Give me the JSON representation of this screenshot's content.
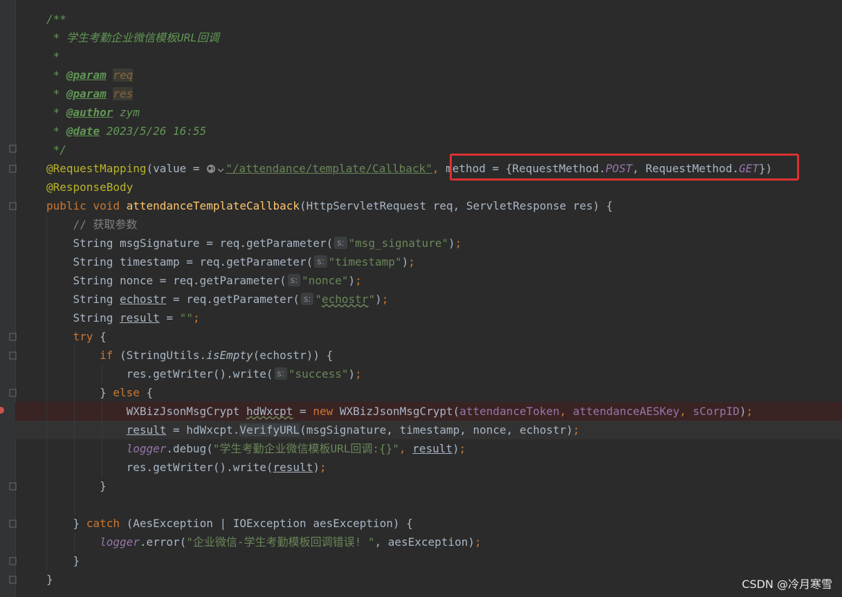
{
  "editor": {
    "javadoc": {
      "open": "/**",
      "star": " *",
      "description": " 学生考勤企业微信模板URL回调",
      "param_tag": "@param",
      "param1": "req",
      "param2": "res",
      "author_tag": "@author",
      "author": " zym",
      "date_tag": "@date",
      "date": " 2023/5/26 16:55",
      "close": " */"
    },
    "mapping": {
      "annotation": "@RequestMapping",
      "value_prefix": "(value = ",
      "url": "\"/attendance/template/Callback\"",
      "comma": ",",
      "method_part_1": " method = {RequestMethod.",
      "post": "POST",
      "method_part_2": ", RequestMethod.",
      "get": "GET",
      "method_part_3": "})"
    },
    "response_body": "@ResponseBody",
    "signature": {
      "modifiers": "public void ",
      "name": "attendanceTemplateCallback",
      "params": "(HttpServletRequest req, ServletResponse res) {"
    },
    "comment_line": "// 获取参数",
    "hint_s": "s:",
    "vars": {
      "msg": "String msgSignature = req.getParameter(",
      "msg_arg": "\"msg_signature\"",
      "ts": "String timestamp = req.getParameter(",
      "ts_arg": "\"timestamp\"",
      "nonce": "String nonce = req.getParameter(",
      "nonce_arg": "\"nonce\"",
      "echo_prefix": "String ",
      "echo_name": "echostr",
      "echo_mid": " = req.getParameter(",
      "echo_arg_q1": "\"",
      "echo_arg": "echostr",
      "echo_arg_q2": "\"",
      "result_prefix": "String ",
      "result_name": "result",
      "result_mid": " = ",
      "result_val": "\"\"",
      "close_paren_semi": ")",
      "semi": ";"
    },
    "try_block": {
      "try_kw": "try",
      "open_brace": " {",
      "if_kw": "if",
      "if_pre": " (StringUtils.",
      "is_empty": "isEmpty",
      "if_post": "(echostr)) {",
      "write_success": "res.getWriter().write(",
      "success_arg": "\"success\"",
      "else_close": "} ",
      "else_kw": "else",
      "crypt_type": "WXBizJsonMsgCrypt ",
      "crypt_var": "hdWxcpt",
      "crypt_eq": " = ",
      "new_kw": "new",
      "crypt_ctor": " WXBizJsonMsgCrypt(",
      "token": "attendanceToken",
      "aes_key": "attendanceAESKey",
      "corp_id": "sCorpID",
      "sep": ", ",
      "result_var": "result",
      "verify_pre": " = hdWxcpt.",
      "verify_call": "VerifyURL",
      "verify_args": "(msgSignature, timestamp, nonce, echostr)",
      "logger": "logger",
      "debug_call": ".debug(",
      "debug_msg": "\"学生考勤企业微信模板URL回调:{}\"",
      "write_call": "res.getWriter().write(",
      "close_brace": "}",
      "catch_pre": "} ",
      "catch_kw": "catch",
      "catch_args": " (AesException | IOException aesException) {",
      "error_call": ".error(",
      "error_msg": "\"企业微信-学生考勤模板回调错误! \"",
      "error_tail": ", aesException)"
    }
  },
  "watermark": "CSDN @冷月寒雪",
  "colors": {
    "background": "#2b2b2b",
    "highlight_border": "#e03030",
    "breakpoint": "#c75450"
  }
}
